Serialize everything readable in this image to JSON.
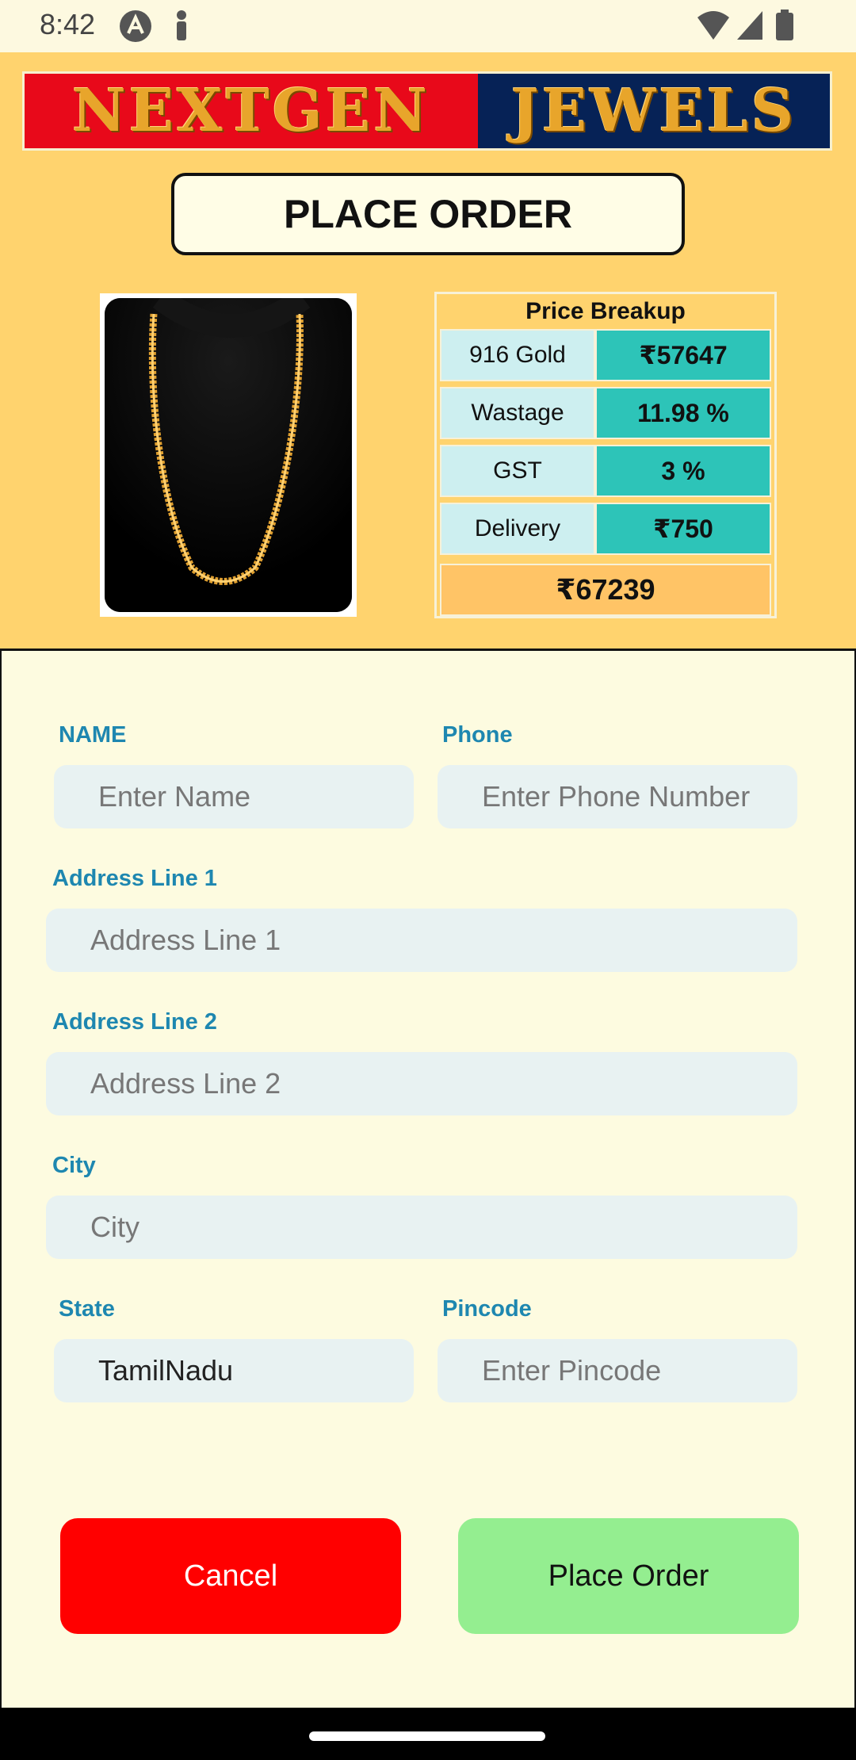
{
  "status_bar": {
    "time": "8:42",
    "icons": [
      "android-debug-icon",
      "notification-icon",
      "wifi-icon",
      "cellular-signal-icon",
      "battery-icon"
    ]
  },
  "header": {
    "logo_left": "NEXTGEN",
    "logo_right": "JEWELS",
    "title": "PLACE ORDER",
    "product_image": "gold-chain-necklace"
  },
  "price_breakup": {
    "title": "Price Breakup",
    "rows": [
      {
        "label": "916 Gold",
        "value": "₹57647"
      },
      {
        "label": "Wastage",
        "value": "11.98 %"
      },
      {
        "label": "GST",
        "value": "3 %"
      },
      {
        "label": "Delivery",
        "value": "₹750"
      }
    ],
    "total": "₹67239"
  },
  "form": {
    "name": {
      "label": "NAME",
      "placeholder": "Enter Name",
      "value": ""
    },
    "phone": {
      "label": "Phone",
      "placeholder": "Enter Phone Number",
      "value": ""
    },
    "address1": {
      "label": "Address Line 1",
      "placeholder": "Address Line 1",
      "value": ""
    },
    "address2": {
      "label": "Address Line 2",
      "placeholder": "Address Line 2",
      "value": ""
    },
    "city": {
      "label": "City",
      "placeholder": "City",
      "value": ""
    },
    "state": {
      "label": "State",
      "placeholder": "",
      "value": "TamilNadu"
    },
    "pincode": {
      "label": "Pincode",
      "placeholder": "Enter Pincode",
      "value": ""
    }
  },
  "buttons": {
    "cancel": "Cancel",
    "place_order": "Place Order"
  },
  "colors": {
    "header_bg": "#FFD36E",
    "form_bg": "#FDFBE0",
    "label": "#1E87B0",
    "cancel": "#FF0000",
    "place_order": "#94EE90",
    "price_value": "#2DC4B8",
    "price_label": "#CDEFF0"
  }
}
